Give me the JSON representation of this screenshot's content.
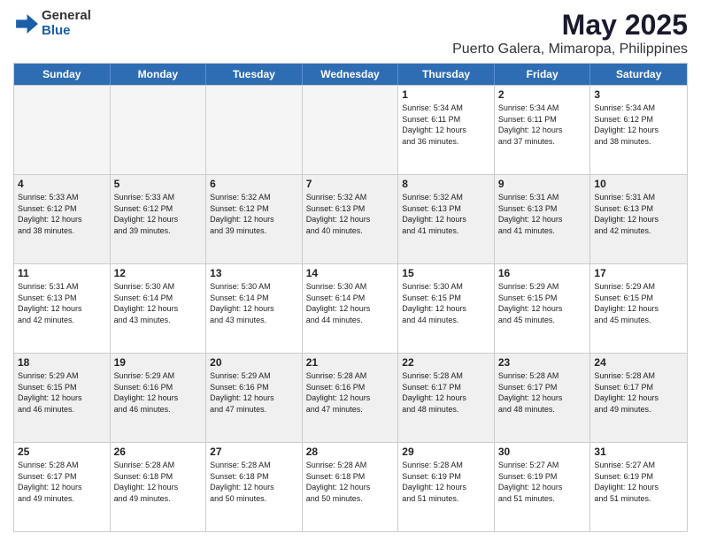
{
  "header": {
    "logo_general": "General",
    "logo_blue": "Blue",
    "title": "May 2025",
    "subtitle": "Puerto Galera, Mimaropa, Philippines"
  },
  "days_of_week": [
    "Sunday",
    "Monday",
    "Tuesday",
    "Wednesday",
    "Thursday",
    "Friday",
    "Saturday"
  ],
  "rows": [
    [
      {
        "day": "",
        "info": "",
        "empty": true
      },
      {
        "day": "",
        "info": "",
        "empty": true
      },
      {
        "day": "",
        "info": "",
        "empty": true
      },
      {
        "day": "",
        "info": "",
        "empty": true
      },
      {
        "day": "1",
        "info": "Sunrise: 5:34 AM\nSunset: 6:11 PM\nDaylight: 12 hours\nand 36 minutes."
      },
      {
        "day": "2",
        "info": "Sunrise: 5:34 AM\nSunset: 6:11 PM\nDaylight: 12 hours\nand 37 minutes."
      },
      {
        "day": "3",
        "info": "Sunrise: 5:34 AM\nSunset: 6:12 PM\nDaylight: 12 hours\nand 38 minutes."
      }
    ],
    [
      {
        "day": "4",
        "info": "Sunrise: 5:33 AM\nSunset: 6:12 PM\nDaylight: 12 hours\nand 38 minutes."
      },
      {
        "day": "5",
        "info": "Sunrise: 5:33 AM\nSunset: 6:12 PM\nDaylight: 12 hours\nand 39 minutes."
      },
      {
        "day": "6",
        "info": "Sunrise: 5:32 AM\nSunset: 6:12 PM\nDaylight: 12 hours\nand 39 minutes."
      },
      {
        "day": "7",
        "info": "Sunrise: 5:32 AM\nSunset: 6:13 PM\nDaylight: 12 hours\nand 40 minutes."
      },
      {
        "day": "8",
        "info": "Sunrise: 5:32 AM\nSunset: 6:13 PM\nDaylight: 12 hours\nand 41 minutes."
      },
      {
        "day": "9",
        "info": "Sunrise: 5:31 AM\nSunset: 6:13 PM\nDaylight: 12 hours\nand 41 minutes."
      },
      {
        "day": "10",
        "info": "Sunrise: 5:31 AM\nSunset: 6:13 PM\nDaylight: 12 hours\nand 42 minutes."
      }
    ],
    [
      {
        "day": "11",
        "info": "Sunrise: 5:31 AM\nSunset: 6:13 PM\nDaylight: 12 hours\nand 42 minutes."
      },
      {
        "day": "12",
        "info": "Sunrise: 5:30 AM\nSunset: 6:14 PM\nDaylight: 12 hours\nand 43 minutes."
      },
      {
        "day": "13",
        "info": "Sunrise: 5:30 AM\nSunset: 6:14 PM\nDaylight: 12 hours\nand 43 minutes."
      },
      {
        "day": "14",
        "info": "Sunrise: 5:30 AM\nSunset: 6:14 PM\nDaylight: 12 hours\nand 44 minutes."
      },
      {
        "day": "15",
        "info": "Sunrise: 5:30 AM\nSunset: 6:15 PM\nDaylight: 12 hours\nand 44 minutes."
      },
      {
        "day": "16",
        "info": "Sunrise: 5:29 AM\nSunset: 6:15 PM\nDaylight: 12 hours\nand 45 minutes."
      },
      {
        "day": "17",
        "info": "Sunrise: 5:29 AM\nSunset: 6:15 PM\nDaylight: 12 hours\nand 45 minutes."
      }
    ],
    [
      {
        "day": "18",
        "info": "Sunrise: 5:29 AM\nSunset: 6:15 PM\nDaylight: 12 hours\nand 46 minutes."
      },
      {
        "day": "19",
        "info": "Sunrise: 5:29 AM\nSunset: 6:16 PM\nDaylight: 12 hours\nand 46 minutes."
      },
      {
        "day": "20",
        "info": "Sunrise: 5:29 AM\nSunset: 6:16 PM\nDaylight: 12 hours\nand 47 minutes."
      },
      {
        "day": "21",
        "info": "Sunrise: 5:28 AM\nSunset: 6:16 PM\nDaylight: 12 hours\nand 47 minutes."
      },
      {
        "day": "22",
        "info": "Sunrise: 5:28 AM\nSunset: 6:17 PM\nDaylight: 12 hours\nand 48 minutes."
      },
      {
        "day": "23",
        "info": "Sunrise: 5:28 AM\nSunset: 6:17 PM\nDaylight: 12 hours\nand 48 minutes."
      },
      {
        "day": "24",
        "info": "Sunrise: 5:28 AM\nSunset: 6:17 PM\nDaylight: 12 hours\nand 49 minutes."
      }
    ],
    [
      {
        "day": "25",
        "info": "Sunrise: 5:28 AM\nSunset: 6:17 PM\nDaylight: 12 hours\nand 49 minutes."
      },
      {
        "day": "26",
        "info": "Sunrise: 5:28 AM\nSunset: 6:18 PM\nDaylight: 12 hours\nand 49 minutes."
      },
      {
        "day": "27",
        "info": "Sunrise: 5:28 AM\nSunset: 6:18 PM\nDaylight: 12 hours\nand 50 minutes."
      },
      {
        "day": "28",
        "info": "Sunrise: 5:28 AM\nSunset: 6:18 PM\nDaylight: 12 hours\nand 50 minutes."
      },
      {
        "day": "29",
        "info": "Sunrise: 5:28 AM\nSunset: 6:19 PM\nDaylight: 12 hours\nand 51 minutes."
      },
      {
        "day": "30",
        "info": "Sunrise: 5:27 AM\nSunset: 6:19 PM\nDaylight: 12 hours\nand 51 minutes."
      },
      {
        "day": "31",
        "info": "Sunrise: 5:27 AM\nSunset: 6:19 PM\nDaylight: 12 hours\nand 51 minutes."
      }
    ]
  ]
}
